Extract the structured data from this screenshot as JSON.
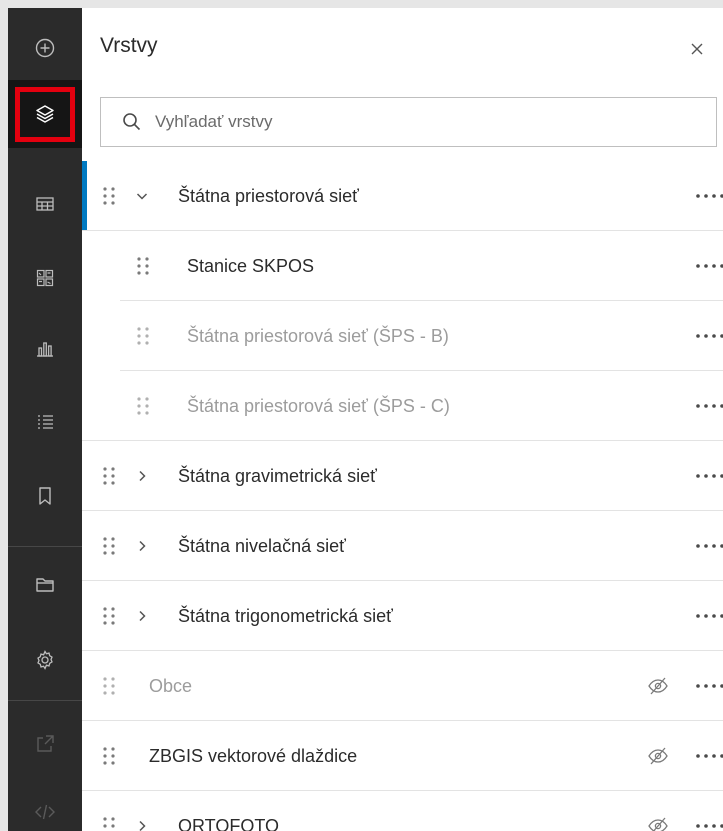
{
  "panel": {
    "title": "Vrstvy",
    "search_placeholder": "Vyhľadať vrstvy"
  },
  "toolbar": {
    "items": [
      {
        "icon": "add-circle-icon"
      },
      {
        "icon": "layers-icon",
        "active": true
      },
      {
        "icon": "table-icon"
      },
      {
        "icon": "basemap-gallery-icon"
      },
      {
        "icon": "bar-chart-icon"
      },
      {
        "icon": "legend-icon"
      },
      {
        "icon": "bookmark-icon"
      },
      {
        "icon": "folder-icon"
      },
      {
        "icon": "gear-icon"
      },
      {
        "icon": "share-icon"
      },
      {
        "icon": "code-icon"
      }
    ]
  },
  "layers": [
    {
      "label": "Štátna priestorová sieť",
      "level": 0,
      "expander": "expanded",
      "selected": true,
      "muted": false,
      "hidden_icon": false
    },
    {
      "label": "Stanice SKPOS",
      "level": 1,
      "expander": "none",
      "selected": false,
      "muted": false,
      "hidden_icon": false
    },
    {
      "label": "Štátna priestorová sieť (ŠPS - B)",
      "level": 1,
      "expander": "none",
      "selected": false,
      "muted": true,
      "hidden_icon": false
    },
    {
      "label": "Štátna priestorová sieť (ŠPS - C)",
      "level": 1,
      "expander": "none",
      "selected": false,
      "muted": true,
      "hidden_icon": false
    },
    {
      "label": "Štátna gravimetrická sieť",
      "level": 0,
      "expander": "collapsed",
      "selected": false,
      "muted": false,
      "hidden_icon": false
    },
    {
      "label": "Štátna nivelačná sieť",
      "level": 0,
      "expander": "collapsed",
      "selected": false,
      "muted": false,
      "hidden_icon": false
    },
    {
      "label": "Štátna trigonometrická sieť",
      "level": 0,
      "expander": "collapsed",
      "selected": false,
      "muted": false,
      "hidden_icon": false
    },
    {
      "label": "Obce",
      "level": 0,
      "expander": "none",
      "selected": false,
      "muted": true,
      "hidden_icon": true
    },
    {
      "label": "ZBGIS vektorové dlaždice",
      "level": 0,
      "expander": "none",
      "selected": false,
      "muted": false,
      "hidden_icon": true
    },
    {
      "label": "ORTOFOTO",
      "level": 0,
      "expander": "collapsed",
      "selected": false,
      "muted": false,
      "hidden_icon": true
    }
  ],
  "colors": {
    "accent": "#0079c1",
    "highlight": "#e3000f",
    "toolbar_bg": "#2b2b2b",
    "text": "#2b2b2b",
    "muted_text": "#9c9c9c"
  }
}
